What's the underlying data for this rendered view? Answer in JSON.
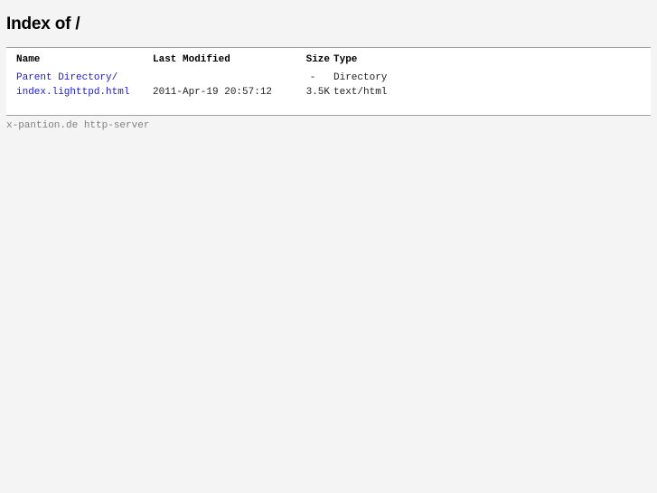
{
  "page": {
    "title": "Index of /"
  },
  "table": {
    "headers": {
      "name": "Name",
      "last_modified": "Last Modified",
      "size": "Size",
      "type": "Type"
    },
    "rows": [
      {
        "name": "Parent Directory/",
        "last_modified": "",
        "size": "-",
        "type": "Directory"
      },
      {
        "name": "index.lighttpd.html",
        "last_modified": "2011-Apr-19 20:57:12",
        "size": "3.5K",
        "type": "text/html"
      }
    ]
  },
  "footer": {
    "text": "x-pantion.de http-server"
  },
  "colors": {
    "background": "#f4f4f4",
    "listing_background": "#ffffff",
    "link": "#1a1ad0",
    "footer_text": "#808080",
    "rule": "#a0a0a0"
  }
}
